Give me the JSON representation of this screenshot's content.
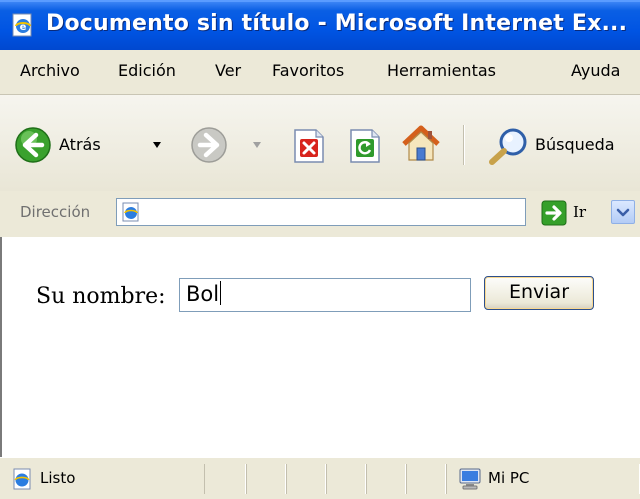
{
  "window": {
    "title": "Documento sin título - Microsoft Internet Ex..."
  },
  "menubar": {
    "items": [
      "Archivo",
      "Edición",
      "Ver",
      "Favoritos",
      "Herramientas",
      "Ayuda"
    ]
  },
  "toolbar": {
    "back_label": "Atrás",
    "search_label": "Búsqueda"
  },
  "addressbar": {
    "label": "Dirección",
    "value": "",
    "go_label": "Ir"
  },
  "content": {
    "form_label": "Su nombre:",
    "name_value": "Bol",
    "submit_label": "Enviar"
  },
  "statusbar": {
    "status_text": "Listo",
    "zone_text": "Mi PC"
  },
  "colors": {
    "titlebar": "#0054e3",
    "chrome": "#ece9d8",
    "back_button": "#3aa12d",
    "go_button": "#35a02a"
  }
}
